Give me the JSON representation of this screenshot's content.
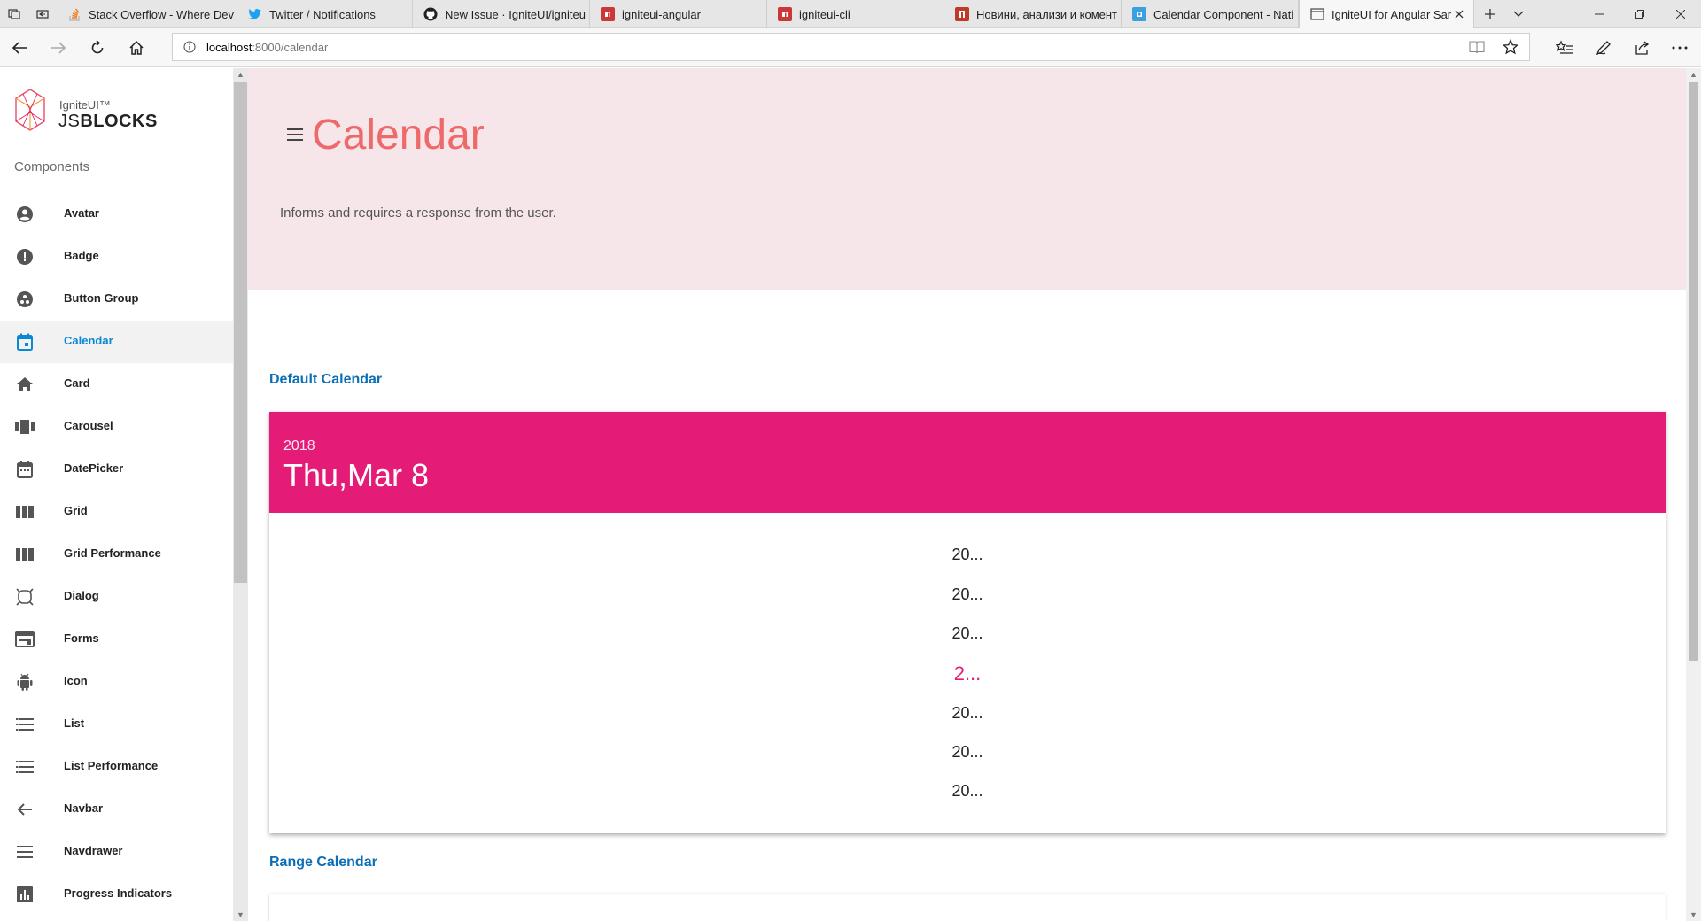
{
  "browser": {
    "tabs": [
      {
        "title": "Stack Overflow - Where Dev",
        "icon": "stackoverflow-icon",
        "color": "#f48024"
      },
      {
        "title": "Twitter / Notifications",
        "icon": "twitter-icon",
        "color": "#1da1f2"
      },
      {
        "title": "New Issue · IgniteUI/igniteu",
        "icon": "github-icon",
        "color": "#222222"
      },
      {
        "title": "igniteui-angular",
        "icon": "npm-icon",
        "color": "#cb3837"
      },
      {
        "title": "igniteui-cli",
        "icon": "npm-icon",
        "color": "#cb3837"
      },
      {
        "title": "Новини, анализи и комент",
        "icon": "news-icon",
        "color": "#c0392b"
      },
      {
        "title": "Calendar Component - Nati",
        "icon": "nativescript-icon",
        "color": "#3aa0de"
      },
      {
        "title": "IgniteUI for Angular Sar",
        "icon": "page-icon",
        "color": "#555555",
        "active": true
      }
    ],
    "url_host": "localhost",
    "url_path": ":8000/calendar"
  },
  "sidebar": {
    "logo_small": "IgniteUI™",
    "logo_light": "JS",
    "logo_bold": "BLOCKS",
    "heading": "Components",
    "items": [
      {
        "label": "Avatar",
        "icon": "account-circle-icon"
      },
      {
        "label": "Badge",
        "icon": "error-icon"
      },
      {
        "label": "Button Group",
        "icon": "group-work-icon"
      },
      {
        "label": "Calendar",
        "icon": "calendar-icon",
        "active": true
      },
      {
        "label": "Card",
        "icon": "home-icon"
      },
      {
        "label": "Carousel",
        "icon": "view-carousel-icon"
      },
      {
        "label": "DatePicker",
        "icon": "date-range-icon"
      },
      {
        "label": "Grid",
        "icon": "grid-columns-icon"
      },
      {
        "label": "Grid Performance",
        "icon": "grid-columns-icon"
      },
      {
        "label": "Dialog",
        "icon": "dialog-icon"
      },
      {
        "label": "Forms",
        "icon": "web-form-icon"
      },
      {
        "label": "Icon",
        "icon": "android-icon"
      },
      {
        "label": "List",
        "icon": "list-icon"
      },
      {
        "label": "List Performance",
        "icon": "list-icon"
      },
      {
        "label": "Navbar",
        "icon": "arrow-back-icon"
      },
      {
        "label": "Navdrawer",
        "icon": "menu-icon"
      },
      {
        "label": "Progress Indicators",
        "icon": "bar-chart-icon"
      }
    ]
  },
  "hero": {
    "title": "Calendar",
    "description": "Informs and requires a response from the user."
  },
  "sections": {
    "default_title": "Default Calendar",
    "range_title": "Range Calendar"
  },
  "calendar": {
    "year": "2018",
    "date_label": "Thu,Mar 8",
    "accent": "#e41c77",
    "years": [
      {
        "label": "20..."
      },
      {
        "label": "20..."
      },
      {
        "label": "20..."
      },
      {
        "label": "2...",
        "selected": true
      },
      {
        "label": "20..."
      },
      {
        "label": "20..."
      },
      {
        "label": "20..."
      }
    ]
  }
}
